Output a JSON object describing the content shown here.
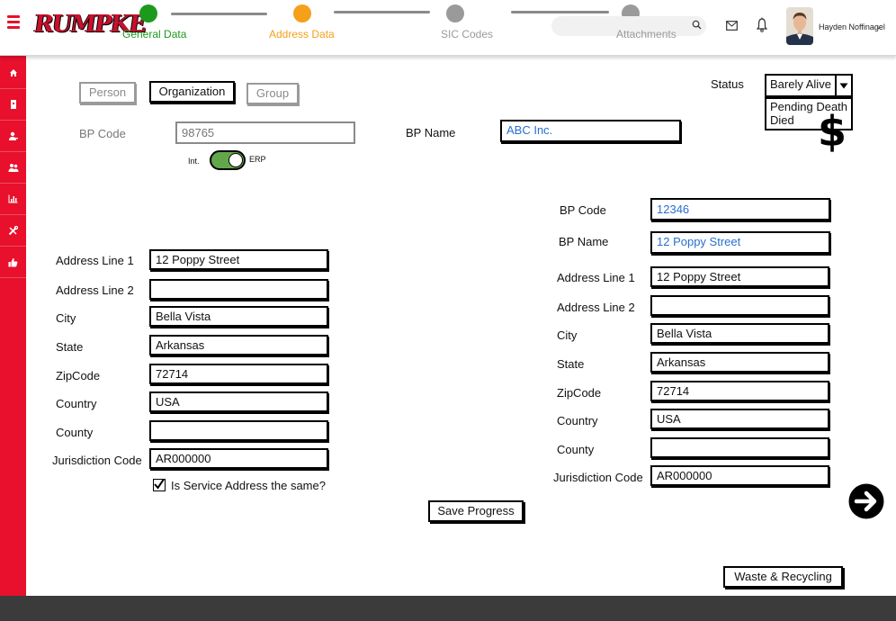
{
  "brand": {
    "logo_text": "RUMPKE"
  },
  "steps": [
    {
      "label": "General Data",
      "color": "#1c9a1c"
    },
    {
      "label": "Address Data",
      "color": "#f5a01a"
    },
    {
      "label": "SIC Codes",
      "color": "#9a9a9a"
    },
    {
      "label": "Attachments",
      "color": "#9a9a9a"
    }
  ],
  "header": {
    "user_name": "Hayden Noffinagel"
  },
  "colors": {
    "accent_red": "#e8102c",
    "link_blue": "#2a6fd0",
    "toggle_green": "#62a84a",
    "footer": "#3b3b3b"
  },
  "sidebar": {
    "icons": [
      "home-icon",
      "document-icon",
      "user-icon",
      "group-icon",
      "chart-icon",
      "tools-icon",
      "thumbs-up-icon"
    ]
  },
  "type_toggle": {
    "options": [
      "Person",
      "Organization",
      "Group"
    ],
    "selected": "Organization"
  },
  "status": {
    "label": "Status",
    "selected": "Barely Alive",
    "options": [
      "Pending Death",
      "Died"
    ],
    "dollar": "$"
  },
  "top_form": {
    "bp_code_label": "BP Code",
    "bp_code_value": "98765",
    "bp_name_label": "BP Name",
    "bp_name_value": "ABC Inc.",
    "toggle_left": "Int.",
    "toggle_right": "ERP"
  },
  "left_address": {
    "fields": [
      {
        "label": "Address Line 1",
        "value": "12 Poppy Street"
      },
      {
        "label": "Address Line 2",
        "value": ""
      },
      {
        "label": "City",
        "value": "Bella Vista"
      },
      {
        "label": "State",
        "value": "Arkansas"
      },
      {
        "label": "ZipCode",
        "value": "72714"
      },
      {
        "label": "Country",
        "value": "USA"
      },
      {
        "label": "County",
        "value": ""
      },
      {
        "label": "Jurisdiction Code",
        "value": "AR000000"
      }
    ],
    "service_checkbox_label": "Is Service Address the same?"
  },
  "right_address": {
    "bp_code_label": "BP Code",
    "bp_code_value": "12346",
    "bp_name_label": "BP Name",
    "bp_name_value": "12 Poppy Street",
    "fields": [
      {
        "label": "Address Line 1",
        "value": "12 Poppy Street"
      },
      {
        "label": "Address Line 2",
        "value": ""
      },
      {
        "label": "City",
        "value": "Bella Vista"
      },
      {
        "label": "State",
        "value": "Arkansas"
      },
      {
        "label": "ZipCode",
        "value": "72714"
      },
      {
        "label": "Country",
        "value": "USA"
      },
      {
        "label": "County",
        "value": ""
      },
      {
        "label": "Jurisdiction Code",
        "value": "AR000000"
      }
    ]
  },
  "actions": {
    "save_label": "Save Progress",
    "waste_label": "Waste & Recycling"
  }
}
